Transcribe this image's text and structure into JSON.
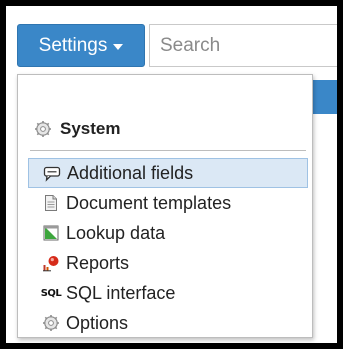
{
  "toolbar": {
    "settings_label": "Settings",
    "search_placeholder": "Search"
  },
  "menu": {
    "group_label": "System",
    "items": [
      {
        "label": "Additional fields",
        "icon": "chat-fields-icon",
        "active": true
      },
      {
        "label": "Document templates",
        "icon": "document-icon",
        "active": false
      },
      {
        "label": "Lookup data",
        "icon": "lookup-icon",
        "active": false
      },
      {
        "label": "Reports",
        "icon": "reports-icon",
        "active": false
      },
      {
        "label": "SQL interface",
        "icon": "sql-icon",
        "active": false
      },
      {
        "label": "Options",
        "icon": "gear-icon",
        "active": false
      }
    ]
  },
  "colors": {
    "accent": "#3a87c8",
    "highlight": "#dbe8f5",
    "highlight_border": "#9fc2e4",
    "frame": "#000000"
  }
}
